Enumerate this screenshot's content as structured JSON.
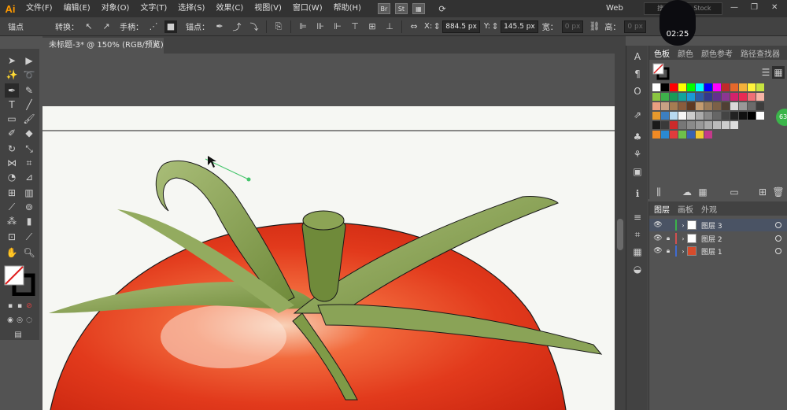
{
  "app": {
    "logo": "Ai"
  },
  "menu": [
    "文件(F)",
    "编辑(E)",
    "对象(O)",
    "文字(T)",
    "选择(S)",
    "效果(C)",
    "视图(V)",
    "窗口(W)",
    "帮助(H)"
  ],
  "menubar_icons": [
    "Br",
    "St"
  ],
  "workspace": "Web",
  "search": {
    "placeholder": "搜索 Adobe Stock"
  },
  "timer": "02:25",
  "control_bar": {
    "anchor_label": "锚点",
    "convert_label": "转换：",
    "handle_label": "手柄：",
    "anchor2_label": "锚点：",
    "x_label": "X:",
    "x_value": "884.5 px",
    "y_label": "Y:",
    "y_value": "145.5 px",
    "w_label": "宽：",
    "w_value": "0 px",
    "h_label": "高：",
    "h_value": "0 px"
  },
  "document_tab": {
    "title": "未标题-3* @ 150% (RGB/预览)",
    "close": "×"
  },
  "swatch_panel": {
    "tabs": [
      "色板",
      "颜色",
      "颜色参考",
      "路径查找器"
    ],
    "active_tab": "色板",
    "rows": [
      [
        "#ffffff",
        "#000000",
        "#ff0000",
        "#ffff00",
        "#00ff00",
        "#00ffff",
        "#0000ff",
        "#ff00ff",
        "#c12a2a",
        "#e5682b",
        "#f3b03a",
        "#fff33b",
        "#c7e440"
      ],
      [
        "#8ac541",
        "#3eb04b",
        "#199b57",
        "#13a49a",
        "#1b9ad6",
        "#2a5ba8",
        "#32388c",
        "#62318f",
        "#8c3692",
        "#d3226b",
        "#e82a53",
        "#ef6f75",
        "#f7b4a6"
      ],
      [
        "#e99f80",
        "#c8a184",
        "#a67c52",
        "#8a5c3c",
        "#5e3a23",
        "#c39b6f",
        "#9a7b59",
        "#7c6147",
        "#504034",
        "#d9d9d9",
        "#999999",
        "#6b6b6b",
        "#3d3d3d"
      ],
      [
        "#e89a2c",
        "#3c7fc1",
        "#b8d9f0",
        "#f6f6f6",
        "#cccccc",
        "#aaaaaa",
        "#888888",
        "#666666",
        "#444444",
        "#222222",
        "#111111",
        "#000000",
        "#ffffff"
      ],
      [
        "#1a1a1a",
        "#3a3a3a",
        "#cc2a2a",
        "#777777",
        "#8a8a8a",
        "#999999",
        "#aaaaaa",
        "#bbbbbb",
        "#cccccc",
        "#dddddd"
      ],
      [
        "#f08a24",
        "#2a8ad2",
        "#e03c3c",
        "#6ec04a",
        "#3a62b0",
        "#f2c832",
        "#c43a8a"
      ]
    ]
  },
  "layers_panel": {
    "tabs": [
      "图层",
      "画板",
      "外观"
    ],
    "active_tab": "图层",
    "layers": [
      {
        "name": "图层 3",
        "color": "#3cb34a",
        "selected": true,
        "thumb": "#ffffff"
      },
      {
        "name": "图层 2",
        "color": "#d25050",
        "selected": false,
        "thumb": "#ffffff"
      },
      {
        "name": "图层 1",
        "color": "#3f6bd1",
        "selected": false,
        "thumb": "#d64b2b"
      }
    ]
  },
  "badge": "63",
  "colors": {
    "accent": "#ff9a00",
    "menubar": "#323232",
    "panel": "#424242",
    "workspace_bg": "#535353",
    "artboard": "#f6f7f3",
    "selection_path": "#43c46a"
  }
}
